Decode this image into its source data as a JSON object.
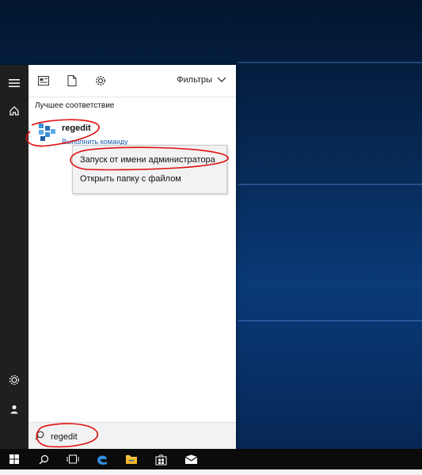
{
  "icons": {
    "menu": "hamburger-icon",
    "home": "home-icon",
    "settings": "gear-icon",
    "user": "user-icon",
    "top1": "view-icon",
    "top2": "document-icon",
    "top3": "settings-icon",
    "search": "search-icon",
    "windows": "windows-icon",
    "taskview": "task-view-icon",
    "edge": "edge-icon",
    "explorer": "file-explorer-icon",
    "store": "store-icon",
    "mail": "mail-icon"
  },
  "start": {
    "filters_label": "Фильтры",
    "best_match_title": "Лучшее соответствие",
    "result": {
      "name": "regedit",
      "subtitle": "Выполнить команду"
    },
    "context_menu": {
      "item1": "Запуск от имени администратора",
      "item2": "Открыть папку с файлом"
    },
    "search_value": "regedit"
  },
  "colors": {
    "rail": "#1f1f1f",
    "accent": "#1a5fb4",
    "annotation": "#e01010"
  }
}
